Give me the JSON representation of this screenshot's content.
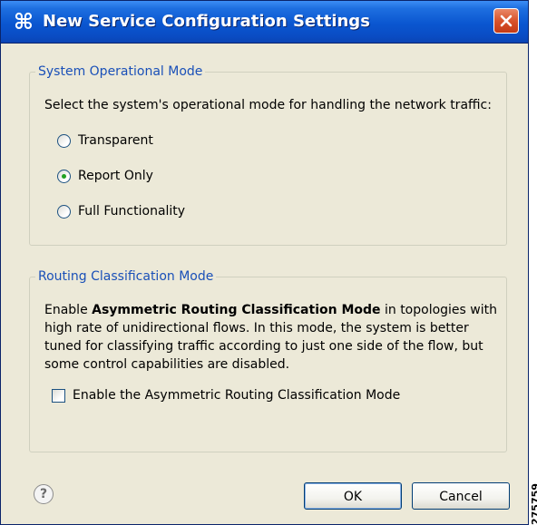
{
  "window": {
    "title": "New Service Configuration Settings",
    "icon": "cisco-command-icon",
    "close_icon": "close-icon"
  },
  "system_mode": {
    "group_label": "System Operational Mode",
    "instruction": "Select the system's operational mode for handling the network traffic:",
    "options": [
      {
        "label": "Transparent",
        "selected": false
      },
      {
        "label": "Report Only",
        "selected": true
      },
      {
        "label": "Full Functionality",
        "selected": false
      }
    ]
  },
  "routing_mode": {
    "group_label": "Routing Classification Mode",
    "desc_prefix": "Enable ",
    "desc_bold": "Asymmetric Routing Classification Mode",
    "desc_suffix": " in topologies with high rate of unidirectional flows. In this mode, the system is better tuned for classifying traffic according to just one side of the flow, but some control capabilities are disabled.",
    "checkbox_label": "Enable the Asymmetric Routing Classification Mode",
    "checkbox_checked": false
  },
  "footer": {
    "help_icon": "?",
    "ok_label": "OK",
    "cancel_label": "Cancel"
  },
  "figure_id": "275759",
  "colors": {
    "titlebar": "#0a56d0",
    "dialog_bg": "#ece9d8",
    "group_label": "#1a50b8",
    "radio_selected": "#21a121"
  }
}
